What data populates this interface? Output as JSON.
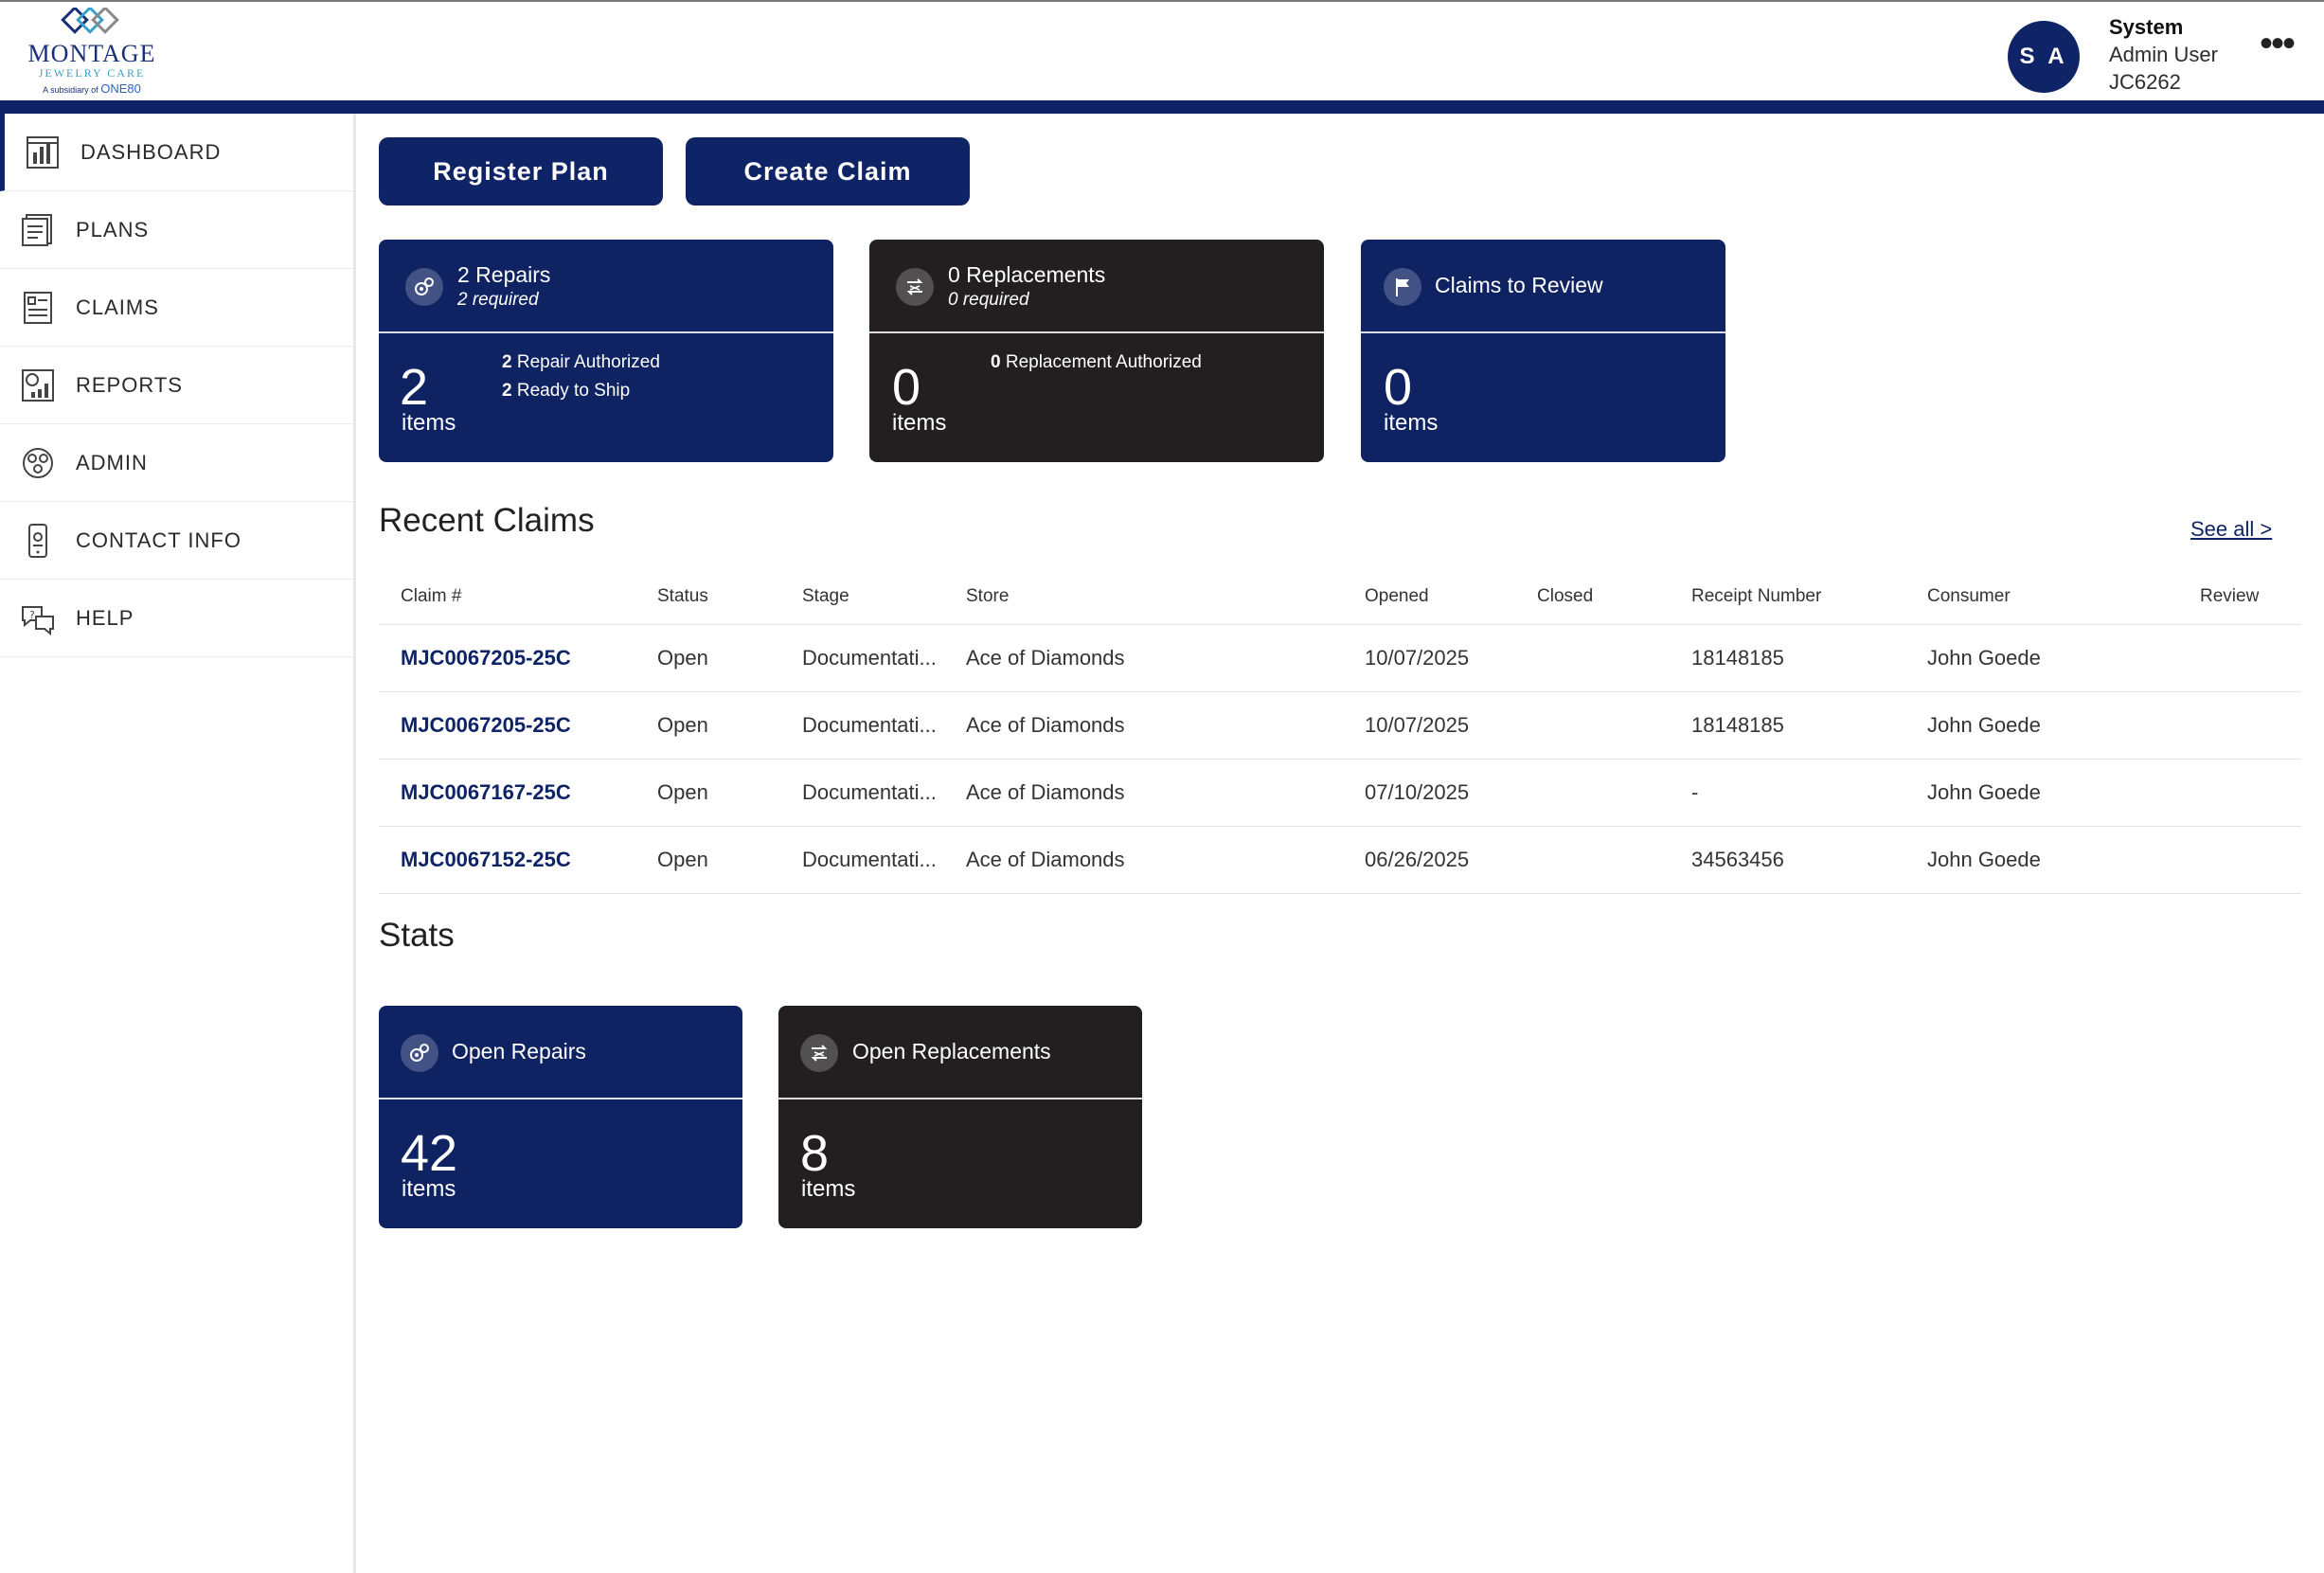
{
  "header": {
    "logo": {
      "name": "MONTAGE",
      "tagline": "JEWELRY CARE",
      "subsidiary_prefix": "A subsidiary of",
      "subsidiary_name": "ONE80"
    },
    "avatar_initials": "S A",
    "user": {
      "name": "System",
      "role": "Admin User",
      "code": "JC6262"
    },
    "more_label": "•••"
  },
  "sidebar": {
    "items": [
      {
        "label": "DASHBOARD",
        "icon": "dashboard-icon"
      },
      {
        "label": "PLANS",
        "icon": "plans-icon"
      },
      {
        "label": "CLAIMS",
        "icon": "claims-icon"
      },
      {
        "label": "REPORTS",
        "icon": "reports-icon"
      },
      {
        "label": "ADMIN",
        "icon": "admin-icon"
      },
      {
        "label": "CONTACT INFO",
        "icon": "contact-icon"
      },
      {
        "label": "HELP",
        "icon": "help-icon"
      }
    ]
  },
  "actions": {
    "register_plan": "Register Plan",
    "create_claim": "Create Claim"
  },
  "summary_cards": {
    "repairs": {
      "title": "2 Repairs",
      "subtitle": "2 required",
      "count": "2",
      "unit": "items",
      "detail1_num": "2",
      "detail1_text": "Repair Authorized",
      "detail2_num": "2",
      "detail2_text": "Ready to Ship"
    },
    "replacements": {
      "title": "0 Replacements",
      "subtitle": "0 required",
      "count": "0",
      "unit": "items",
      "detail1_num": "0",
      "detail1_text": "Replacement Authorized"
    },
    "review": {
      "title": "Claims to Review",
      "count": "0",
      "unit": "items"
    }
  },
  "recent_claims": {
    "title": "Recent Claims",
    "see_all": "See all >",
    "columns": [
      "Claim #",
      "Status",
      "Stage",
      "Store",
      "Opened",
      "Closed",
      "Receipt Number",
      "Consumer",
      "Review"
    ],
    "rows": [
      {
        "claim": "MJC0067205-25C",
        "status": "Open",
        "stage": "Documentati...",
        "store": "Ace of Diamonds",
        "opened": "10/07/2025",
        "closed": "",
        "receipt": "18148185",
        "consumer": "John Goede",
        "review": ""
      },
      {
        "claim": "MJC0067205-25C",
        "status": "Open",
        "stage": "Documentati...",
        "store": "Ace of Diamonds",
        "opened": "10/07/2025",
        "closed": "",
        "receipt": "18148185",
        "consumer": "John Goede",
        "review": ""
      },
      {
        "claim": "MJC0067167-25C",
        "status": "Open",
        "stage": "Documentati...",
        "store": "Ace of Diamonds",
        "opened": "07/10/2025",
        "closed": "",
        "receipt": "-",
        "consumer": "John Goede",
        "review": ""
      },
      {
        "claim": "MJC0067152-25C",
        "status": "Open",
        "stage": "Documentati...",
        "store": "Ace of Diamonds",
        "opened": "06/26/2025",
        "closed": "",
        "receipt": "34563456",
        "consumer": "John Goede",
        "review": ""
      }
    ]
  },
  "stats": {
    "title": "Stats",
    "open_repairs": {
      "title": "Open Repairs",
      "count": "42",
      "unit": "items"
    },
    "open_replacements": {
      "title": "Open Replacements",
      "count": "8",
      "unit": "items"
    }
  },
  "colors": {
    "navy": "#0f2262",
    "dark": "#231f20",
    "accent": "#0f2466"
  }
}
